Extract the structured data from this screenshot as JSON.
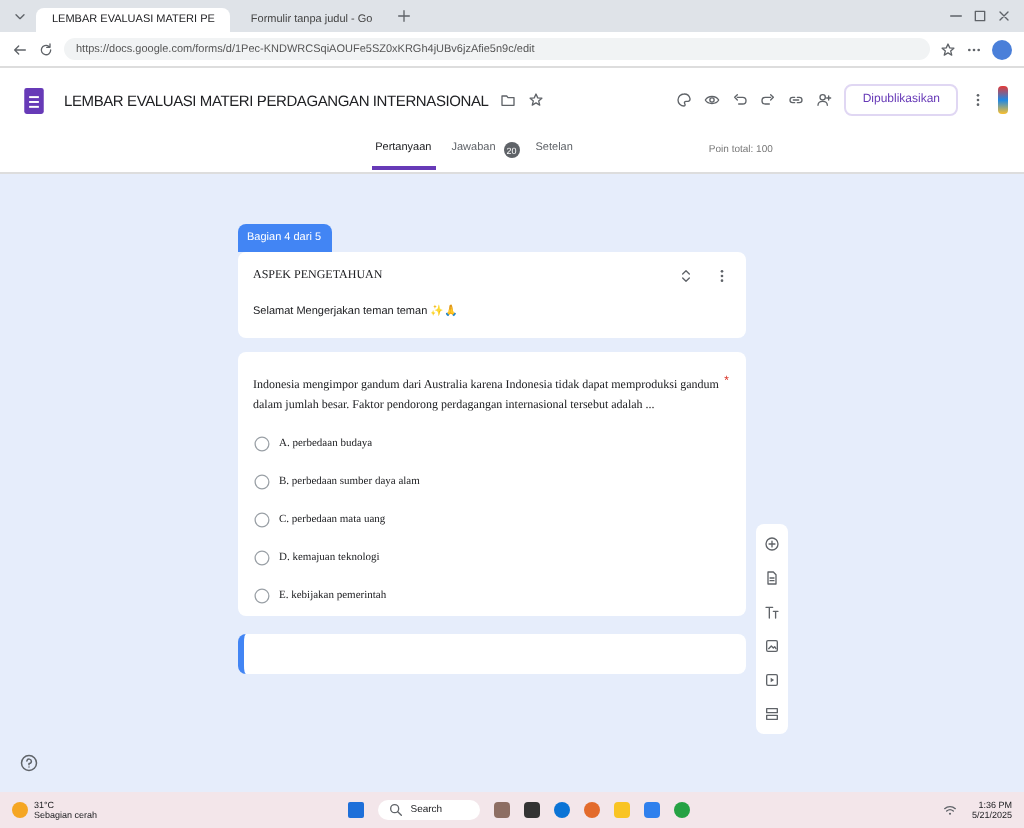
{
  "browser": {
    "tabs": [
      {
        "title": "LEMBAR EVALUASI MATERI PE",
        "selected": true
      },
      {
        "title": "Formulir tanpa judul - Go",
        "selected": false
      }
    ],
    "url": "https://docs.google.com/forms/d/1Pec-KNDWRCSqiAOUFe5SZ0xKRGh4jUBv6jzAfie5n9c/edit"
  },
  "form_header": {
    "title": "LEMBAR EVALUASI MATERI PERDAGANGAN INTERNASIONAL",
    "publish_button": "Dipublikasikan",
    "tabs": [
      {
        "label": "Pertanyaan",
        "selected": true
      },
      {
        "label": "Jawaban",
        "selected": false,
        "badge": "20"
      },
      {
        "label": "Setelan",
        "selected": false
      }
    ],
    "points": "Poin total: 100"
  },
  "section": {
    "tag": "Bagian 4 dari 5",
    "title": "ASPEK PENGETAHUAN",
    "description": "Selamat Mengerjakan teman teman ✨🙏"
  },
  "question": {
    "text": "Indonesia mengimpor gandum dari Australia karena Indonesia tidak dapat memproduksi gandum dalam jumlah besar. Faktor pendorong perdagangan internasional tersebut adalah ...",
    "required_mark": "*",
    "options": [
      {
        "label": "A. perbedaan budaya",
        "selected": false
      },
      {
        "label": "B. perbedaan sumber daya alam",
        "selected": false
      },
      {
        "label": "C. perbedaan mata uang",
        "selected": false
      },
      {
        "label": "D. kemajuan teknologi",
        "selected": false
      },
      {
        "label": "E. kebijakan pemerintah",
        "selected": false
      }
    ]
  },
  "taskbar": {
    "weather_temp": "31°C",
    "weather_text": "Sebagian cerah",
    "search": "Search",
    "time": "1:36 PM",
    "date": "5/21/2025"
  }
}
